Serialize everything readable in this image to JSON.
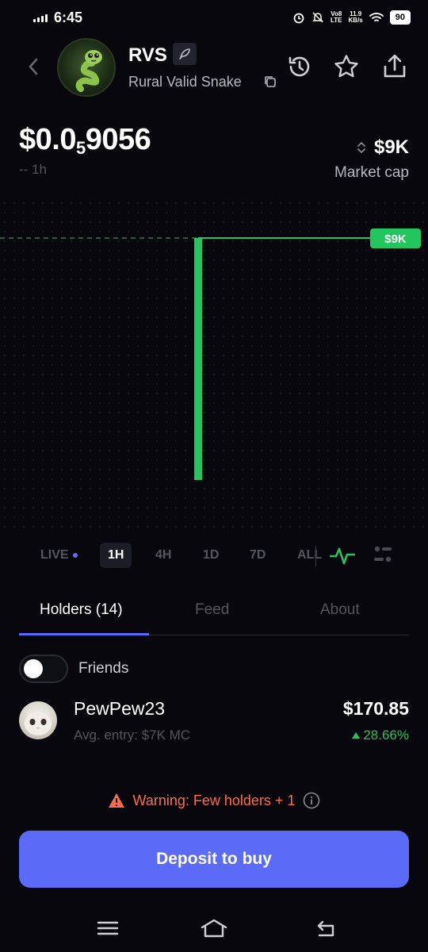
{
  "status_bar": {
    "time": "6:45",
    "volte": "Vo8\nLTE",
    "speed": "11.9\nKB/s",
    "battery": "90"
  },
  "header": {
    "ticker": "RVS",
    "name": "Rural Valid Snake"
  },
  "price": {
    "main": "$0.0",
    "sub": "5",
    "rest": "9056",
    "change": "-- 1h"
  },
  "market_cap": {
    "value": "$9K",
    "label": "Market cap"
  },
  "chart_data": {
    "type": "line",
    "price_tag": "$9K",
    "accent": "#22c55e"
  },
  "timeframes": [
    {
      "label": "LIVE"
    },
    {
      "label": "1H"
    },
    {
      "label": "4H"
    },
    {
      "label": "1D"
    },
    {
      "label": "7D"
    },
    {
      "label": "ALL"
    }
  ],
  "tabs": [
    {
      "label": "Holders (14)"
    },
    {
      "label": "Feed"
    },
    {
      "label": "About"
    }
  ],
  "friends_toggle": {
    "label": "Friends",
    "on": false
  },
  "holder": {
    "name": "PewPew23",
    "avg_entry": "Avg. entry: $7K MC",
    "value": "$170.85",
    "pct": "28.66%"
  },
  "warning": {
    "text": "Warning: Few holders + 1"
  },
  "deposit_button": {
    "label": "Deposit to buy"
  },
  "colors": {
    "accent": "#5b6bf7",
    "positive": "#22c55e",
    "warning": "#ff6b4a",
    "background": "#07070d"
  }
}
